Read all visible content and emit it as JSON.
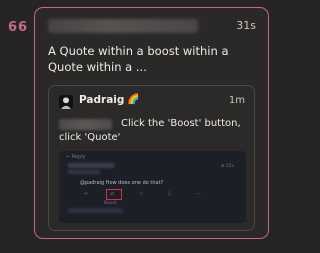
{
  "gutter": {
    "quote_mark": "66"
  },
  "post": {
    "time": "31s",
    "text": "A Quote within a boost within a Quote within a ..."
  },
  "quoted_post": {
    "author": "Padraig",
    "emoji": "🌈",
    "time": "1m",
    "text": "Click the 'Boost' button, click 'Quote'",
    "screenshot": {
      "reply_label": "← Reply",
      "time": "⊕ 25s",
      "question": "@padraig How does one do that?",
      "boost_label": "Boost"
    }
  },
  "colors": {
    "accent": "#c2678b",
    "background": "#262524",
    "boost_highlight": "#d0333d"
  },
  "icons": {
    "reply": "reply-icon",
    "boost": "boost-icon",
    "favourite": "star-icon",
    "bookmark": "bookmark-icon",
    "more": "more-icon"
  }
}
